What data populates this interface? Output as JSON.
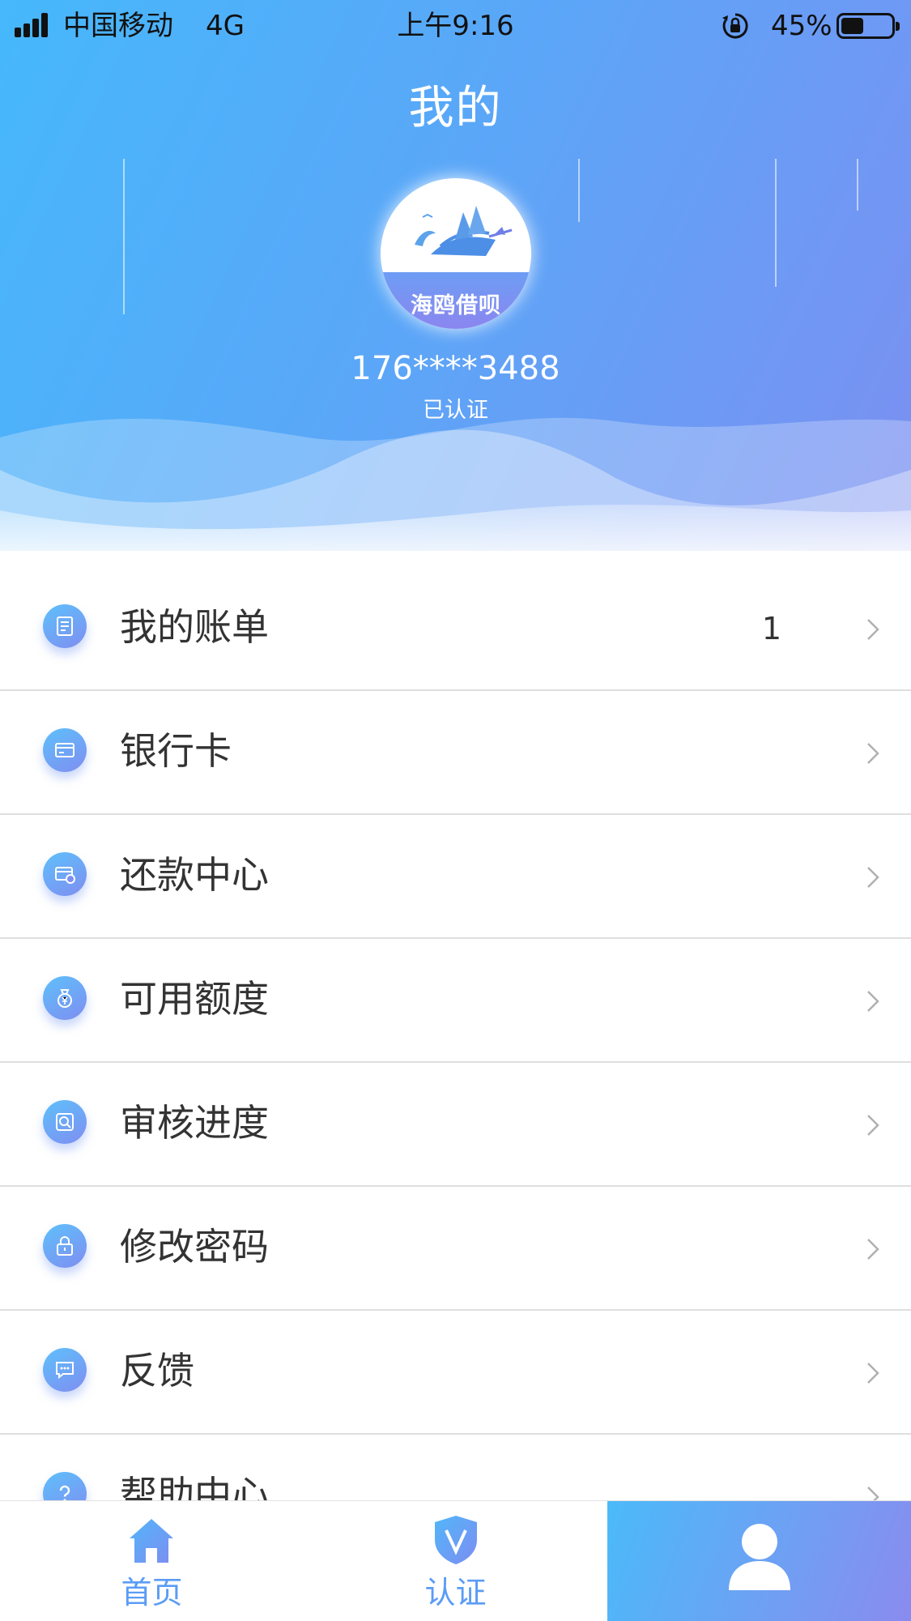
{
  "status_bar": {
    "carrier": "中国移动",
    "network": "4G",
    "time": "上午9:16",
    "battery_percent": "45%",
    "battery_level": 0.45
  },
  "header": {
    "title": "我的",
    "avatar_text": "海鸥借呗",
    "phone": "176****3488",
    "verify_status": "已认证"
  },
  "menu": [
    {
      "label": "我的账单",
      "badge": "1",
      "icon": "bill-icon"
    },
    {
      "label": "银行卡",
      "badge": "",
      "icon": "bank-card-icon"
    },
    {
      "label": "还款中心",
      "badge": "",
      "icon": "repay-icon"
    },
    {
      "label": "可用额度",
      "badge": "",
      "icon": "money-bag-icon"
    },
    {
      "label": "审核进度",
      "badge": "",
      "icon": "review-icon"
    },
    {
      "label": "修改密码",
      "badge": "",
      "icon": "lock-icon"
    },
    {
      "label": "反馈",
      "badge": "",
      "icon": "feedback-icon"
    },
    {
      "label": "帮助中心",
      "badge": "",
      "icon": "help-icon"
    }
  ],
  "tabbar": {
    "home": "首页",
    "verify": "认证"
  },
  "colors": {
    "accent": "#5b9cf5",
    "header_start": "#46b8fb",
    "header_end": "#7c8ff1"
  }
}
